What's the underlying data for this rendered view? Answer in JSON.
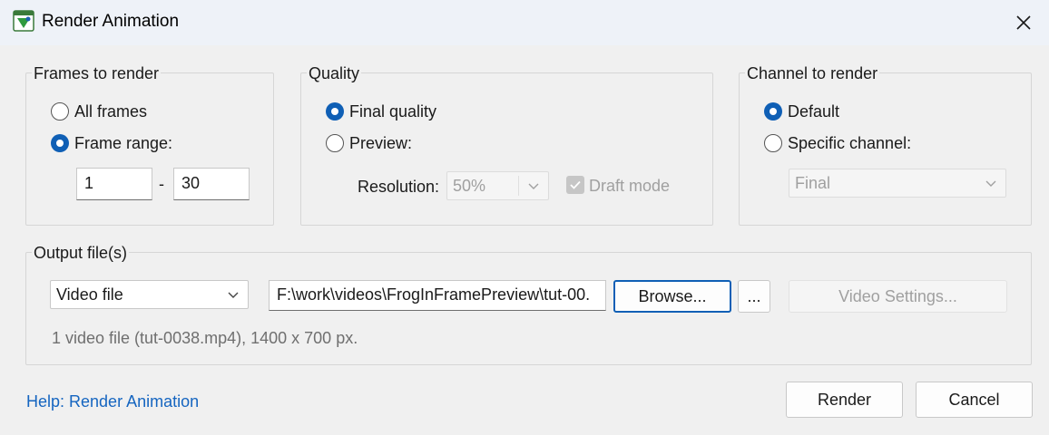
{
  "window": {
    "title": "Render Animation",
    "app_icon": "render-app-icon",
    "close_icon": "close-icon"
  },
  "frames": {
    "legend": "Frames to render",
    "options": [
      {
        "label": "All frames",
        "checked": false
      },
      {
        "label": "Frame range:",
        "checked": true
      }
    ],
    "range_from": "1",
    "range_separator": "-",
    "range_to": "30"
  },
  "quality": {
    "legend": "Quality",
    "options": [
      {
        "label": "Final quality",
        "checked": true
      },
      {
        "label": "Preview:",
        "checked": false
      }
    ],
    "resolution_label": "Resolution:",
    "resolution_value": "50%",
    "draft_label": "Draft mode",
    "draft_checked": true,
    "draft_enabled": false
  },
  "channel": {
    "legend": "Channel to render",
    "options": [
      {
        "label": "Default",
        "checked": true
      },
      {
        "label": "Specific channel:",
        "checked": false
      }
    ],
    "channel_value": "Final"
  },
  "output": {
    "legend": "Output file(s)",
    "type_value": "Video file",
    "path_value": "F:\\work\\videos\\FrogInFramePreview\\tut-00.",
    "browse_label": "Browse...",
    "more_label": "...",
    "video_settings_label": "Video Settings...",
    "summary": "1 video file (tut-0038.mp4), 1400 x 700 px."
  },
  "footer": {
    "help_link": "Help: Render Animation",
    "render_label": "Render",
    "cancel_label": "Cancel"
  },
  "colors": {
    "accent": "#0f5fb5",
    "link": "#1565c0",
    "background": "#f0f0f0",
    "titlebar": "#eef2f8"
  }
}
